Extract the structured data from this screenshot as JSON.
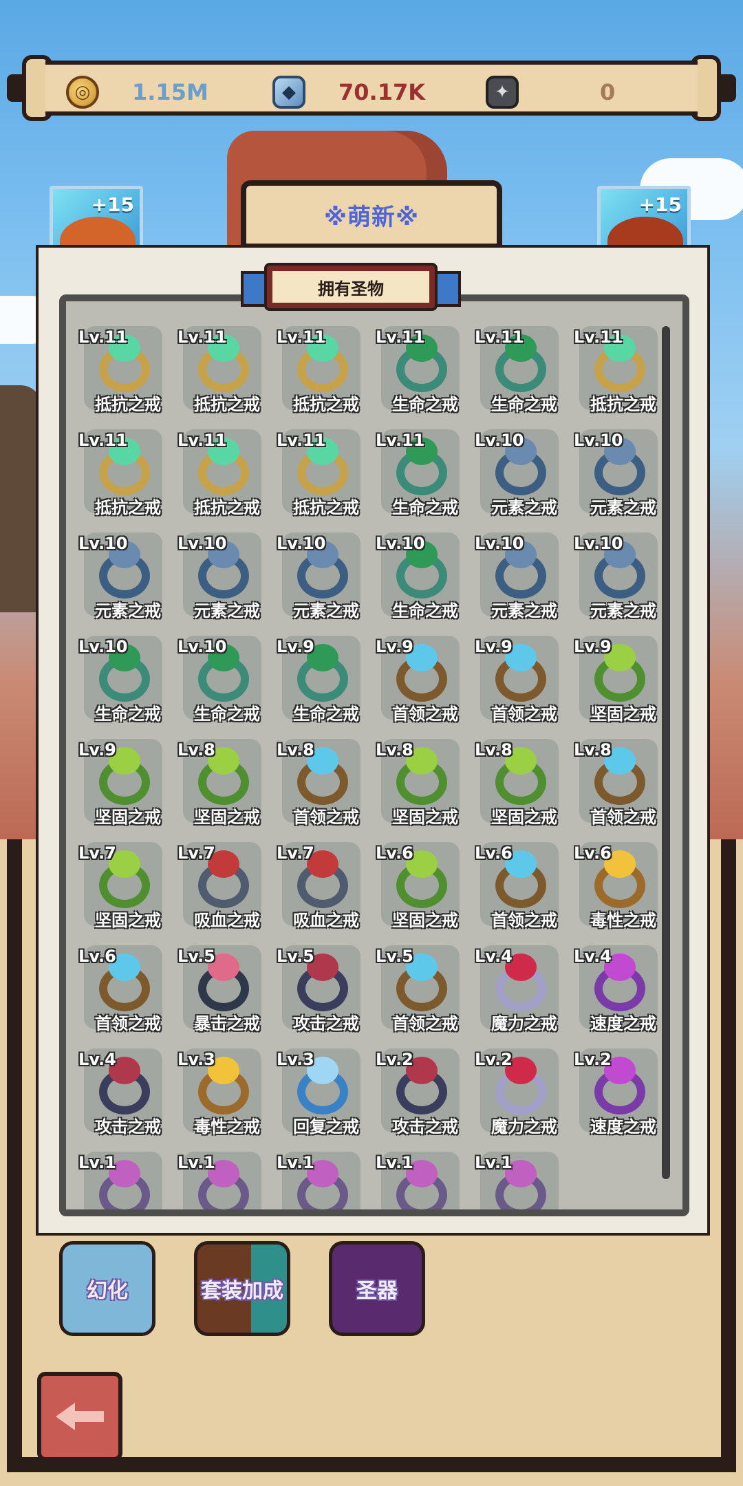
{
  "currencies": [
    {
      "icon": "gold-coin-icon",
      "value": "1.15M",
      "color": "#6b9ec9"
    },
    {
      "icon": "blue-crystal-icon",
      "value": "70.17K",
      "color": "#9c2f2f"
    },
    {
      "icon": "dark-rune-icon",
      "value": "0",
      "color": "#a37a5a"
    }
  ],
  "hero_cards": {
    "left_badge": "+15",
    "right_badge": "+15"
  },
  "title": "※萌新※",
  "panel_title": "拥有圣物",
  "ring_styles": {
    "抵抗之戒": {
      "band": "#c6a24a",
      "gem": "#58d6a4"
    },
    "生命之戒": {
      "band": "#3c8a78",
      "gem": "#2f9a58"
    },
    "元素之戒": {
      "band": "#3c5e82",
      "gem": "#6a8ab0"
    },
    "首领之戒": {
      "band": "#7d5a2e",
      "gem": "#5ec8ea"
    },
    "坚固之戒": {
      "band": "#4f8f2f",
      "gem": "#9bd044"
    },
    "吸血之戒": {
      "band": "#4f5c70",
      "gem": "#c23a3a"
    },
    "毒性之戒": {
      "band": "#9c6a2a",
      "gem": "#f2c23a"
    },
    "暴击之戒": {
      "band": "#2f3848",
      "gem": "#e06a8a"
    },
    "攻击之戒": {
      "band": "#3a3e5c",
      "gem": "#b0384c"
    },
    "魔力之戒": {
      "band": "#a0a0c8",
      "gem": "#d02a4a"
    },
    "速度之戒": {
      "band": "#7a3aa8",
      "gem": "#c04ad0"
    },
    "回复之戒": {
      "band": "#3a82c8",
      "gem": "#9fd6f4"
    }
  },
  "items": [
    {
      "level": "Lv.11",
      "name": "抵抗之戒"
    },
    {
      "level": "Lv.11",
      "name": "抵抗之戒"
    },
    {
      "level": "Lv.11",
      "name": "抵抗之戒"
    },
    {
      "level": "Lv.11",
      "name": "生命之戒"
    },
    {
      "level": "Lv.11",
      "name": "生命之戒"
    },
    {
      "level": "Lv.11",
      "name": "抵抗之戒"
    },
    {
      "level": "Lv.11",
      "name": "抵抗之戒"
    },
    {
      "level": "Lv.11",
      "name": "抵抗之戒"
    },
    {
      "level": "Lv.11",
      "name": "抵抗之戒"
    },
    {
      "level": "Lv.11",
      "name": "生命之戒"
    },
    {
      "level": "Lv.10",
      "name": "元素之戒"
    },
    {
      "level": "Lv.10",
      "name": "元素之戒"
    },
    {
      "level": "Lv.10",
      "name": "元素之戒"
    },
    {
      "level": "Lv.10",
      "name": "元素之戒"
    },
    {
      "level": "Lv.10",
      "name": "元素之戒"
    },
    {
      "level": "Lv.10",
      "name": "生命之戒"
    },
    {
      "level": "Lv.10",
      "name": "元素之戒"
    },
    {
      "level": "Lv.10",
      "name": "元素之戒"
    },
    {
      "level": "Lv.10",
      "name": "生命之戒"
    },
    {
      "level": "Lv.10",
      "name": "生命之戒"
    },
    {
      "level": "Lv.9",
      "name": "生命之戒"
    },
    {
      "level": "Lv.9",
      "name": "首领之戒"
    },
    {
      "level": "Lv.9",
      "name": "首领之戒"
    },
    {
      "level": "Lv.9",
      "name": "坚固之戒"
    },
    {
      "level": "Lv.9",
      "name": "坚固之戒"
    },
    {
      "level": "Lv.8",
      "name": "坚固之戒"
    },
    {
      "level": "Lv.8",
      "name": "首领之戒"
    },
    {
      "level": "Lv.8",
      "name": "坚固之戒"
    },
    {
      "level": "Lv.8",
      "name": "坚固之戒"
    },
    {
      "level": "Lv.8",
      "name": "首领之戒"
    },
    {
      "level": "Lv.7",
      "name": "坚固之戒"
    },
    {
      "level": "Lv.7",
      "name": "吸血之戒"
    },
    {
      "level": "Lv.7",
      "name": "吸血之戒"
    },
    {
      "level": "Lv.6",
      "name": "坚固之戒"
    },
    {
      "level": "Lv.6",
      "name": "首领之戒"
    },
    {
      "level": "Lv.6",
      "name": "毒性之戒"
    },
    {
      "level": "Lv.6",
      "name": "首领之戒"
    },
    {
      "level": "Lv.5",
      "name": "暴击之戒"
    },
    {
      "level": "Lv.5",
      "name": "攻击之戒"
    },
    {
      "level": "Lv.5",
      "name": "首领之戒"
    },
    {
      "level": "Lv.4",
      "name": "魔力之戒"
    },
    {
      "level": "Lv.4",
      "name": "速度之戒"
    },
    {
      "level": "Lv.4",
      "name": "攻击之戒"
    },
    {
      "level": "Lv.3",
      "name": "毒性之戒"
    },
    {
      "level": "Lv.3",
      "name": "回复之戒"
    },
    {
      "level": "Lv.2",
      "name": "攻击之戒"
    },
    {
      "level": "Lv.2",
      "name": "魔力之戒"
    },
    {
      "level": "Lv.2",
      "name": "速度之戒"
    },
    {
      "level": "Lv.1",
      "name": ""
    },
    {
      "level": "Lv.1",
      "name": ""
    },
    {
      "level": "Lv.1",
      "name": ""
    },
    {
      "level": "Lv.1",
      "name": ""
    },
    {
      "level": "Lv.1",
      "name": ""
    }
  ],
  "bottom_menu": [
    {
      "label": "幻化",
      "icon": "transform-icon",
      "bg": "#7fb7d8"
    },
    {
      "label": "套装加成",
      "icon": "set-bonus-icon",
      "bg": "#6b3a22"
    },
    {
      "label": "圣器",
      "icon": "artifact-icon",
      "bg": "#5a2a6e"
    }
  ],
  "back_button": {
    "icon": "back-arrow-icon"
  }
}
